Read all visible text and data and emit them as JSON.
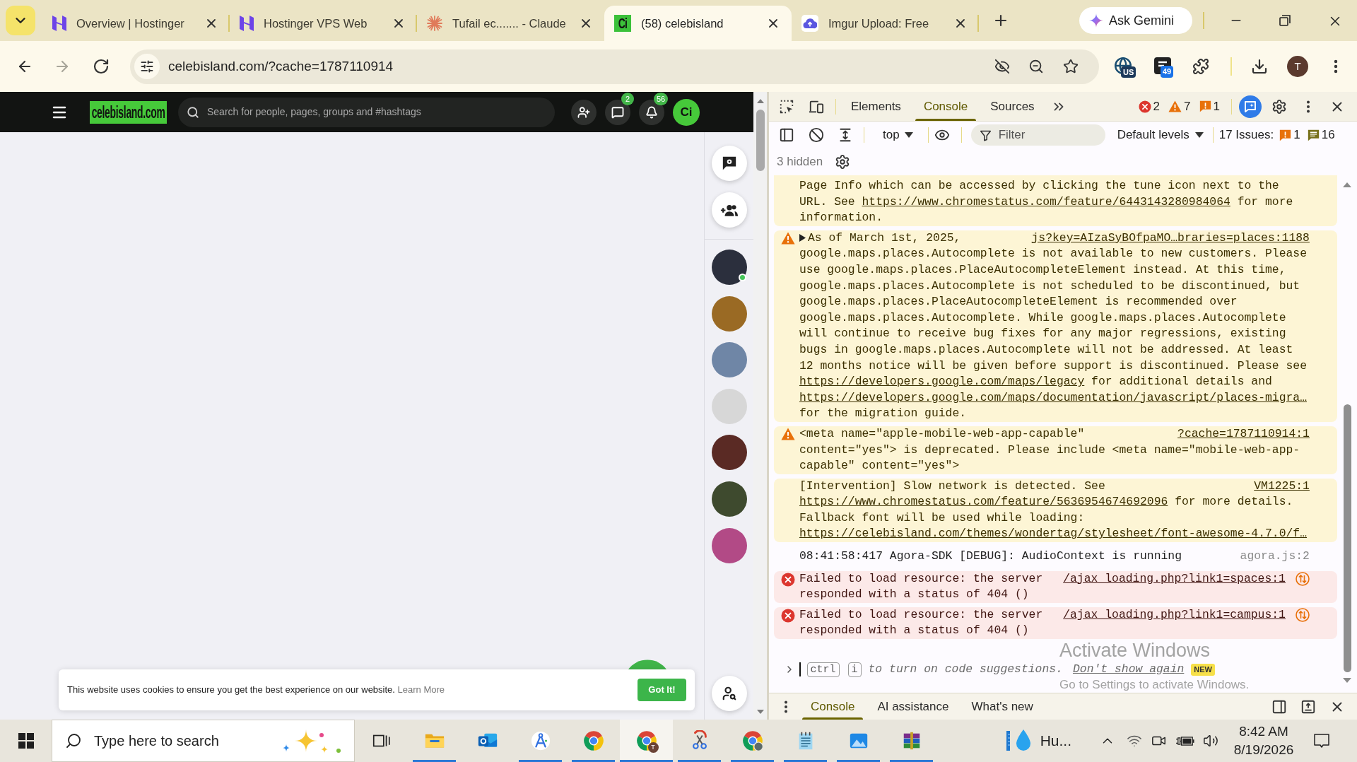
{
  "browser": {
    "tabs": [
      {
        "kind": "hmark",
        "title": "Overview | Hostinger",
        "selected": false
      },
      {
        "kind": "hmark",
        "title": "Hostinger VPS Web",
        "selected": false
      },
      {
        "kind": "asterisk",
        "title": "Tufail ec....... - Claude",
        "selected": false
      },
      {
        "kind": "monogram",
        "favicon_label": "Ci",
        "title": "(58) celebisland",
        "selected": true
      },
      {
        "kind": "cloud",
        "title": "Imgur Upload: Free",
        "selected": false
      }
    ],
    "ask_gemini": "Ask Gemini",
    "url": "celebisland.com/?cache=1787110914",
    "vpn_badge": "US",
    "extensions_badge": "49",
    "profile_initial": "T"
  },
  "site": {
    "logo": "celebisland.com",
    "search_placeholder": "Search for people, pages, groups and #hashtags",
    "messages_badge": "2",
    "notifications_badge": "56",
    "avatar_label": "Ci",
    "contacts": [
      {
        "online": true
      },
      {
        "online": false
      },
      {
        "online": false
      },
      {
        "online": false
      },
      {
        "online": false
      },
      {
        "online": false
      },
      {
        "online": false
      }
    ],
    "cookie_banner": {
      "text": "This website uses cookies to ensure you get the best experience on our website.",
      "link": "Learn More",
      "button": "Got It!"
    }
  },
  "devtools": {
    "tabs": [
      {
        "label": "Elements",
        "selected": false
      },
      {
        "label": "Console",
        "selected": true
      },
      {
        "label": "Sources",
        "selected": false
      }
    ],
    "error_count": "2",
    "warning_count": "7",
    "issue_count": "1",
    "context": "top",
    "filter_placeholder": "Filter",
    "levels": "Default levels",
    "issues_label": "17 Issues:",
    "issues_errors": "1",
    "issues_info": "16",
    "hidden": "3 hidden",
    "messages": [
      {
        "kind": "warning",
        "icon": false,
        "expandable": false,
        "parts": [
          {
            "kind": "text",
            "text": "Page Info which can be accessed by clicking the tune icon next to the URL. See "
          },
          {
            "kind": "link",
            "text": "https://www.chromestatus.com/feature/6443143280984064"
          },
          {
            "kind": "text",
            "text": " for more information."
          }
        ]
      },
      {
        "kind": "warning",
        "icon": true,
        "expandable": true,
        "parts": [
          {
            "kind": "text",
            "text": "As of March 1st, 2025, "
          },
          {
            "kind": "source",
            "text": "js?key=AIzaSyBOfpaMO…braries=places:1188",
            "network_icon": false
          },
          {
            "kind": "text",
            "text": "google.maps.places.Autocomplete is not available to new customers. Please use google.maps.places.PlaceAutocompleteElement instead. At this time, google.maps.places.Autocomplete is not scheduled to be discontinued, but google.maps.places.PlaceAutocompleteElement is recommended over google.maps.places.Autocomplete. While google.maps.places.Autocomplete will continue to receive bug fixes for any major regressions, existing bugs in google.maps.places.Autocomplete will not be addressed. At least 12 months notice will be given before support is discontinued. Please see "
          },
          {
            "kind": "link",
            "text": "https://developers.google.com/maps/legacy"
          },
          {
            "kind": "text",
            "text": " for additional details and "
          },
          {
            "kind": "link",
            "text": "https://developers.google.com/maps/documentation/javascript/places-migra…"
          },
          {
            "kind": "text",
            "text": " for the migration guide."
          }
        ]
      },
      {
        "kind": "warning",
        "icon": true,
        "expandable": false,
        "parts": [
          {
            "kind": "text",
            "text": "<meta name=\"apple-mobile-web-app-capable\" "
          },
          {
            "kind": "source",
            "text": "?cache=1787110914:1",
            "network_icon": false
          },
          {
            "kind": "text",
            "text": "content=\"yes\"> is deprecated. Please include <meta name=\"mobile-web-app-capable\" content=\"yes\">"
          }
        ]
      },
      {
        "kind": "warning",
        "icon": false,
        "expandable": false,
        "parts": [
          {
            "kind": "text",
            "text": "[Intervention] Slow network is detected. See "
          },
          {
            "kind": "source",
            "text": "VM1225:1",
            "network_icon": false
          },
          {
            "kind": "link",
            "text": "https://www.chromestatus.com/feature/5636954674692096"
          },
          {
            "kind": "text",
            "text": " for more details. Fallback font will be used while loading: "
          },
          {
            "kind": "link",
            "text": "https://celebisland.com/themes/wondertag/stylesheet/font-awesome-4.7.0/f…"
          }
        ]
      },
      {
        "kind": "info",
        "icon": false,
        "expandable": false,
        "parts": [
          {
            "kind": "text",
            "text": "08:41:58:417 Agora-SDK [DEBUG]: AudioContext is running "
          },
          {
            "kind": "source",
            "text": "agora.js:2",
            "network_icon": false
          }
        ]
      },
      {
        "kind": "error",
        "icon": true,
        "expandable": false,
        "parts": [
          {
            "kind": "text",
            "text": "Failed to load resource: the server "
          },
          {
            "kind": "source",
            "text": "/ajax_loading.php?link1=spaces:1",
            "network_icon": true
          },
          {
            "kind": "text",
            "text": "responded with a status of 404 ()"
          }
        ]
      },
      {
        "kind": "error",
        "icon": true,
        "expandable": false,
        "parts": [
          {
            "kind": "text",
            "text": "Failed to load resource: the server "
          },
          {
            "kind": "source",
            "text": "/ajax_loading.php?link1=campus:1",
            "network_icon": true
          },
          {
            "kind": "text",
            "text": "responded with a status of 404 ()"
          }
        ]
      }
    ],
    "prompt": {
      "keys": [
        "ctrl",
        "i"
      ],
      "hint": "to turn on code suggestions.",
      "dismiss": "Don't show again",
      "badge": "NEW"
    },
    "drawer_tabs": [
      {
        "label": "Console",
        "selected": true
      },
      {
        "label": "AI assistance",
        "selected": false
      },
      {
        "label": "What's new",
        "selected": false
      }
    ]
  },
  "watermark": {
    "title": "Activate Windows",
    "subtitle": "Go to Settings to activate Windows."
  },
  "taskbar": {
    "search_placeholder": "Type here to search",
    "apps": [
      {
        "kind": "taskview",
        "running": false,
        "selected": false
      },
      {
        "kind": "explorer",
        "running": true,
        "selected": false
      },
      {
        "kind": "mail",
        "running": false,
        "selected": false
      },
      {
        "kind": "compass",
        "running": true,
        "selected": false
      },
      {
        "kind": "chrome",
        "running": true,
        "selected": false
      },
      {
        "kind": "chrome",
        "badge": "T",
        "running": true,
        "selected": true
      },
      {
        "kind": "scissors",
        "running": true,
        "selected": false
      },
      {
        "kind": "chromephoto",
        "running": true,
        "selected": false
      },
      {
        "kind": "notepad",
        "running": true,
        "selected": false
      },
      {
        "kind": "photos",
        "running": true,
        "selected": false
      },
      {
        "kind": "archive",
        "running": true,
        "selected": false
      }
    ],
    "weather": "Hu...",
    "time": "8:42 AM",
    "date": "8/19/2026"
  }
}
